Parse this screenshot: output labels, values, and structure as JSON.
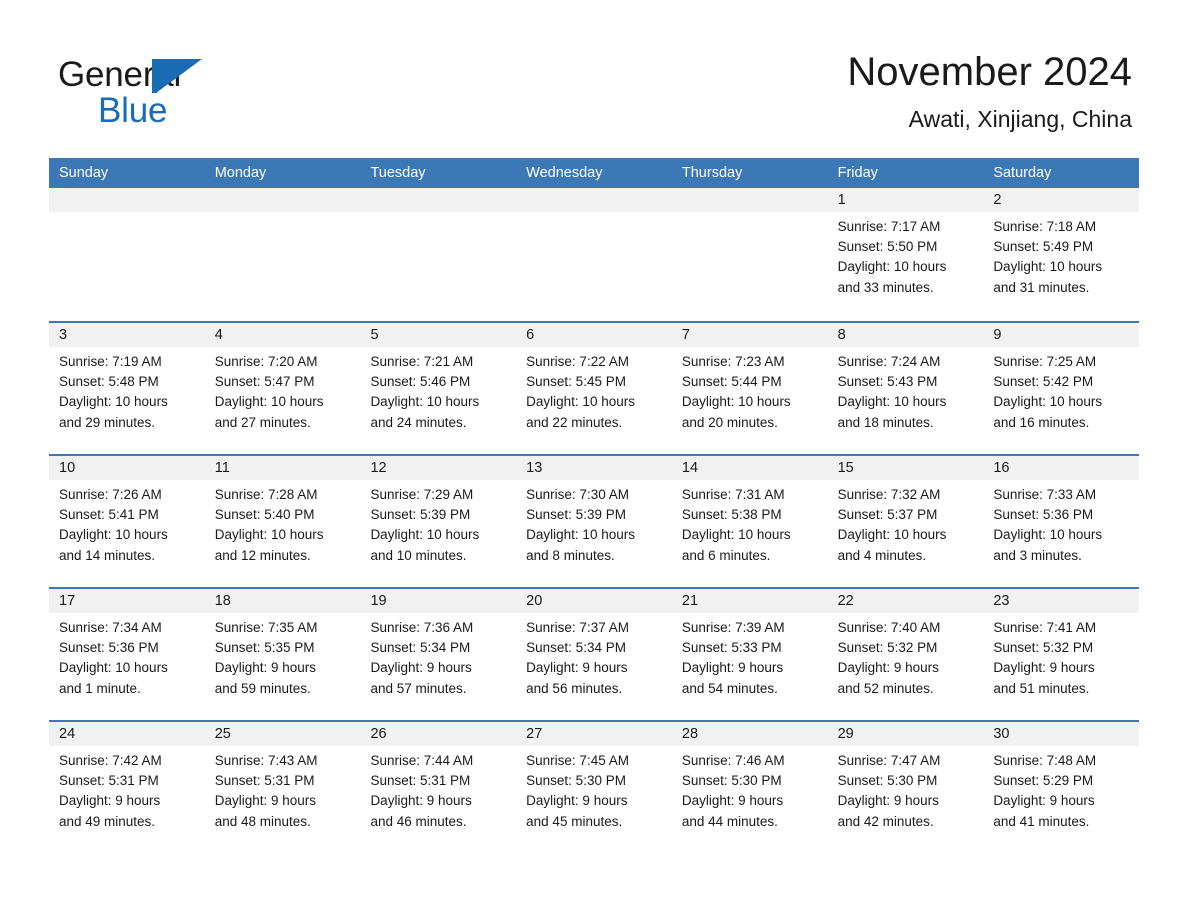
{
  "brand": {
    "name_part1": "General",
    "name_part2": "Blue",
    "accent_color": "#1a6cb5",
    "header_color": "#3b78b5",
    "daynum_band_color": "#f1f1f1"
  },
  "header": {
    "title": "November 2024",
    "subtitle": "Awati, Xinjiang, China"
  },
  "weekday_headers": [
    "Sunday",
    "Monday",
    "Tuesday",
    "Wednesday",
    "Thursday",
    "Friday",
    "Saturday"
  ],
  "weeks": [
    [
      {
        "day": "",
        "lines": []
      },
      {
        "day": "",
        "lines": []
      },
      {
        "day": "",
        "lines": []
      },
      {
        "day": "",
        "lines": []
      },
      {
        "day": "",
        "lines": []
      },
      {
        "day": "1",
        "lines": [
          "Sunrise: 7:17 AM",
          "Sunset: 5:50 PM",
          "Daylight: 10 hours",
          "and 33 minutes."
        ]
      },
      {
        "day": "2",
        "lines": [
          "Sunrise: 7:18 AM",
          "Sunset: 5:49 PM",
          "Daylight: 10 hours",
          "and 31 minutes."
        ]
      }
    ],
    [
      {
        "day": "3",
        "lines": [
          "Sunrise: 7:19 AM",
          "Sunset: 5:48 PM",
          "Daylight: 10 hours",
          "and 29 minutes."
        ]
      },
      {
        "day": "4",
        "lines": [
          "Sunrise: 7:20 AM",
          "Sunset: 5:47 PM",
          "Daylight: 10 hours",
          "and 27 minutes."
        ]
      },
      {
        "day": "5",
        "lines": [
          "Sunrise: 7:21 AM",
          "Sunset: 5:46 PM",
          "Daylight: 10 hours",
          "and 24 minutes."
        ]
      },
      {
        "day": "6",
        "lines": [
          "Sunrise: 7:22 AM",
          "Sunset: 5:45 PM",
          "Daylight: 10 hours",
          "and 22 minutes."
        ]
      },
      {
        "day": "7",
        "lines": [
          "Sunrise: 7:23 AM",
          "Sunset: 5:44 PM",
          "Daylight: 10 hours",
          "and 20 minutes."
        ]
      },
      {
        "day": "8",
        "lines": [
          "Sunrise: 7:24 AM",
          "Sunset: 5:43 PM",
          "Daylight: 10 hours",
          "and 18 minutes."
        ]
      },
      {
        "day": "9",
        "lines": [
          "Sunrise: 7:25 AM",
          "Sunset: 5:42 PM",
          "Daylight: 10 hours",
          "and 16 minutes."
        ]
      }
    ],
    [
      {
        "day": "10",
        "lines": [
          "Sunrise: 7:26 AM",
          "Sunset: 5:41 PM",
          "Daylight: 10 hours",
          "and 14 minutes."
        ]
      },
      {
        "day": "11",
        "lines": [
          "Sunrise: 7:28 AM",
          "Sunset: 5:40 PM",
          "Daylight: 10 hours",
          "and 12 minutes."
        ]
      },
      {
        "day": "12",
        "lines": [
          "Sunrise: 7:29 AM",
          "Sunset: 5:39 PM",
          "Daylight: 10 hours",
          "and 10 minutes."
        ]
      },
      {
        "day": "13",
        "lines": [
          "Sunrise: 7:30 AM",
          "Sunset: 5:39 PM",
          "Daylight: 10 hours",
          "and 8 minutes."
        ]
      },
      {
        "day": "14",
        "lines": [
          "Sunrise: 7:31 AM",
          "Sunset: 5:38 PM",
          "Daylight: 10 hours",
          "and 6 minutes."
        ]
      },
      {
        "day": "15",
        "lines": [
          "Sunrise: 7:32 AM",
          "Sunset: 5:37 PM",
          "Daylight: 10 hours",
          "and 4 minutes."
        ]
      },
      {
        "day": "16",
        "lines": [
          "Sunrise: 7:33 AM",
          "Sunset: 5:36 PM",
          "Daylight: 10 hours",
          "and 3 minutes."
        ]
      }
    ],
    [
      {
        "day": "17",
        "lines": [
          "Sunrise: 7:34 AM",
          "Sunset: 5:36 PM",
          "Daylight: 10 hours",
          "and 1 minute."
        ]
      },
      {
        "day": "18",
        "lines": [
          "Sunrise: 7:35 AM",
          "Sunset: 5:35 PM",
          "Daylight: 9 hours",
          "and 59 minutes."
        ]
      },
      {
        "day": "19",
        "lines": [
          "Sunrise: 7:36 AM",
          "Sunset: 5:34 PM",
          "Daylight: 9 hours",
          "and 57 minutes."
        ]
      },
      {
        "day": "20",
        "lines": [
          "Sunrise: 7:37 AM",
          "Sunset: 5:34 PM",
          "Daylight: 9 hours",
          "and 56 minutes."
        ]
      },
      {
        "day": "21",
        "lines": [
          "Sunrise: 7:39 AM",
          "Sunset: 5:33 PM",
          "Daylight: 9 hours",
          "and 54 minutes."
        ]
      },
      {
        "day": "22",
        "lines": [
          "Sunrise: 7:40 AM",
          "Sunset: 5:32 PM",
          "Daylight: 9 hours",
          "and 52 minutes."
        ]
      },
      {
        "day": "23",
        "lines": [
          "Sunrise: 7:41 AM",
          "Sunset: 5:32 PM",
          "Daylight: 9 hours",
          "and 51 minutes."
        ]
      }
    ],
    [
      {
        "day": "24",
        "lines": [
          "Sunrise: 7:42 AM",
          "Sunset: 5:31 PM",
          "Daylight: 9 hours",
          "and 49 minutes."
        ]
      },
      {
        "day": "25",
        "lines": [
          "Sunrise: 7:43 AM",
          "Sunset: 5:31 PM",
          "Daylight: 9 hours",
          "and 48 minutes."
        ]
      },
      {
        "day": "26",
        "lines": [
          "Sunrise: 7:44 AM",
          "Sunset: 5:31 PM",
          "Daylight: 9 hours",
          "and 46 minutes."
        ]
      },
      {
        "day": "27",
        "lines": [
          "Sunrise: 7:45 AM",
          "Sunset: 5:30 PM",
          "Daylight: 9 hours",
          "and 45 minutes."
        ]
      },
      {
        "day": "28",
        "lines": [
          "Sunrise: 7:46 AM",
          "Sunset: 5:30 PM",
          "Daylight: 9 hours",
          "and 44 minutes."
        ]
      },
      {
        "day": "29",
        "lines": [
          "Sunrise: 7:47 AM",
          "Sunset: 5:30 PM",
          "Daylight: 9 hours",
          "and 42 minutes."
        ]
      },
      {
        "day": "30",
        "lines": [
          "Sunrise: 7:48 AM",
          "Sunset: 5:29 PM",
          "Daylight: 9 hours",
          "and 41 minutes."
        ]
      }
    ]
  ]
}
